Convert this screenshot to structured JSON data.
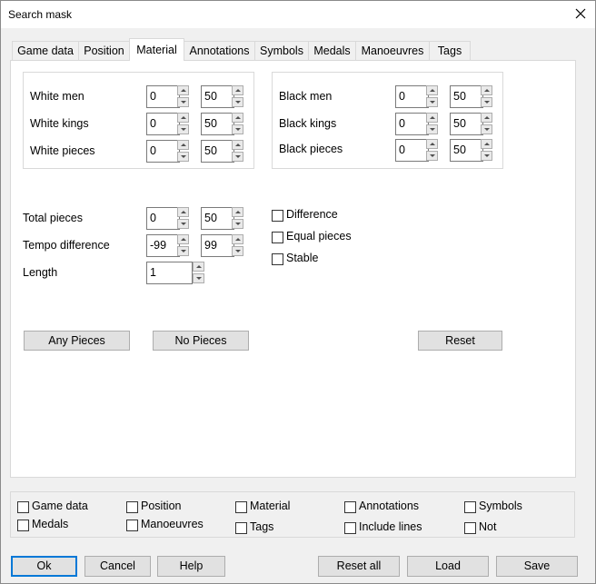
{
  "window": {
    "title": "Search mask"
  },
  "tabs": [
    "Game data",
    "Position",
    "Material",
    "Annotations",
    "Symbols",
    "Medals",
    "Manoeuvres",
    "Tags"
  ],
  "active_tab": "Material",
  "white_group": {
    "rows": [
      {
        "label": "White men",
        "min": "0",
        "max": "50"
      },
      {
        "label": "White kings",
        "min": "0",
        "max": "50"
      },
      {
        "label": "White pieces",
        "min": "0",
        "max": "50"
      }
    ]
  },
  "black_group": {
    "rows": [
      {
        "label": "Black men",
        "min": "0",
        "max": "50"
      },
      {
        "label": "Black kings",
        "min": "0",
        "max": "50"
      },
      {
        "label": "Black pieces",
        "min": "0",
        "max": "50"
      }
    ]
  },
  "totals": {
    "total_pieces": {
      "label": "Total pieces",
      "min": "0",
      "max": "50"
    },
    "tempo_difference": {
      "label": "Tempo difference",
      "min": "-99",
      "max": "99"
    },
    "length": {
      "label": "Length",
      "value": "1"
    }
  },
  "options": {
    "difference": "Difference",
    "equal_pieces": "Equal pieces",
    "stable": "Stable"
  },
  "panel_buttons": {
    "any_pieces": "Any Pieces",
    "no_pieces": "No Pieces",
    "reset": "Reset"
  },
  "filters": {
    "game_data": "Game data",
    "position": "Position",
    "material": "Material",
    "annotations": "Annotations",
    "symbols": "Symbols",
    "medals": "Medals",
    "manoeuvres": "Manoeuvres",
    "tags": "Tags",
    "include_lines": "Include lines",
    "not": "Not"
  },
  "dialog_buttons": {
    "ok": "Ok",
    "cancel": "Cancel",
    "help": "Help",
    "reset_all": "Reset all",
    "load": "Load",
    "save": "Save"
  }
}
